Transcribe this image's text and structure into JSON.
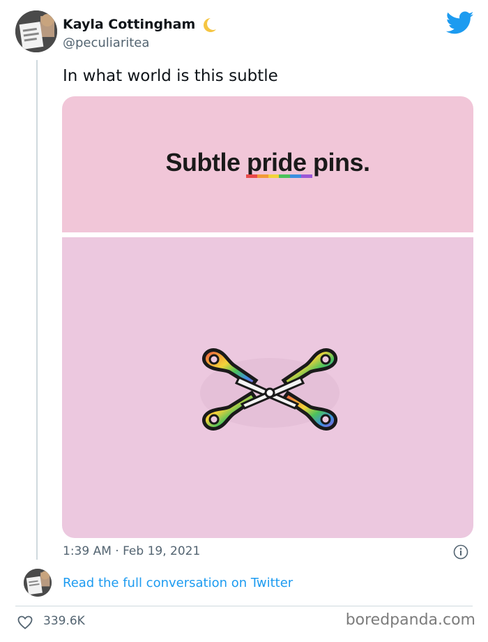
{
  "tweet": {
    "display_name": "Kayla Cottingham",
    "handle": "@peculiaritea",
    "text": "In what world is this subtle",
    "timestamp": "1:39 AM · Feb 19, 2021"
  },
  "media": {
    "headline": "Subtle pride pins.",
    "underline_colors": [
      "#e84a4a",
      "#f29a38",
      "#f2d33a",
      "#4cc25c",
      "#3d8fe0",
      "#9b57d6"
    ]
  },
  "footer": {
    "read_link": "Read the full conversation on Twitter",
    "like_count": "339.6K",
    "watermark": "boredpanda.com"
  },
  "colors": {
    "accent": "#1d9bf0",
    "secondary_text": "#536471"
  },
  "icons": [
    "moon-icon",
    "twitter-bird-icon",
    "info-icon",
    "heart-icon"
  ]
}
